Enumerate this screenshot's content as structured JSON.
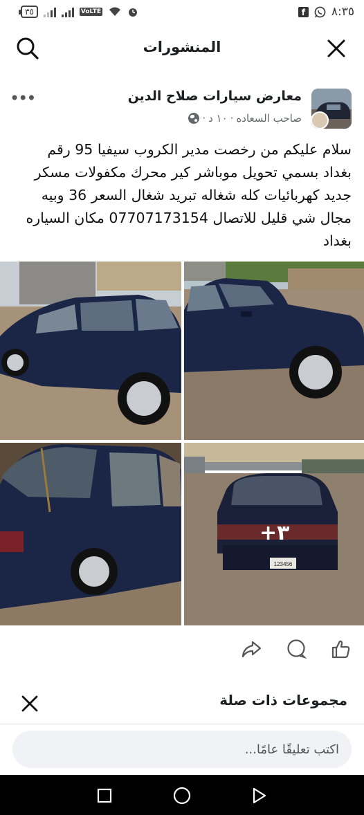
{
  "status_bar": {
    "time": "٨:٣٥",
    "battery": "٣٥",
    "network_badge": "VoLTE",
    "icons": [
      "facebook-icon",
      "whatsapp-icon",
      "wifi-icon",
      "volte-icon",
      "signal-icon",
      "battery-icon",
      "alarm-icon"
    ]
  },
  "header": {
    "title": "المنشورات",
    "icons": [
      "close-icon",
      "search-icon"
    ]
  },
  "post": {
    "page_name": "معارض سيارات صلاح الدين",
    "author": "صاحب السعاده",
    "time_ago": "١٠ د",
    "audience_icon": "globe-icon",
    "more_icon": "more-icon",
    "body": "سلام عليكم من رخصت مدير الكروب سيفيا 95 رقم\nبغداد بسمي تحويل موباشر كير محرك مكفولات  مسكر\nجديد كهربائيات كله شغاله تبريد شغال السعر 36 وبيه\nمجال شي قليل للاتصال 07707173154 مكان السياره\nبغداد",
    "more_photos_label": "+٣",
    "plate_text": "123456",
    "actions": {
      "icons": [
        "like-icon",
        "comment-icon",
        "share-icon"
      ]
    }
  },
  "related": {
    "title": "مجموعات ذات صلة",
    "close_icon": "close-icon"
  },
  "comment_input": {
    "placeholder": "اكتب تعليقًا عامًا..."
  },
  "nav_bar": {
    "icons": [
      "back-icon",
      "home-icon",
      "recent-apps-icon"
    ]
  },
  "colors": {
    "background": "#ffffff",
    "text": "#1c1e21",
    "secondary_text": "#65676b",
    "input_background": "#f0f2f5",
    "nav_bar": "#000000",
    "car_body": "#1b2647"
  }
}
